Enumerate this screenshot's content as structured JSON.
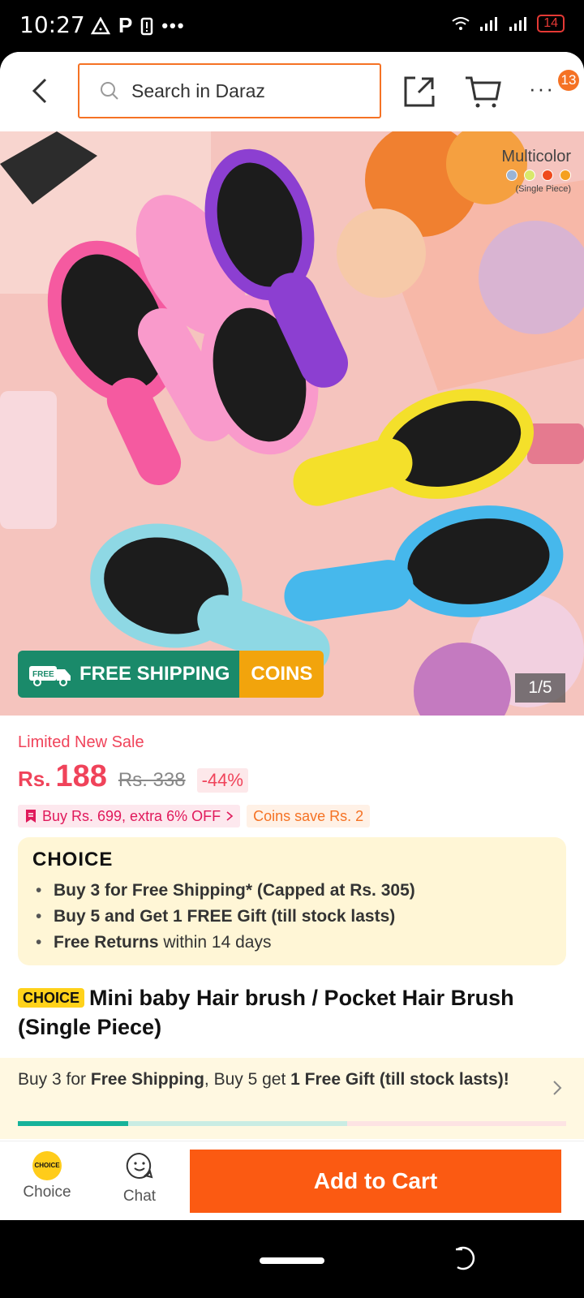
{
  "status_bar": {
    "time": "10:27",
    "left_icons": [
      "alert-icon",
      "parking-icon",
      "battery-alert-icon",
      "more-dots-icon"
    ],
    "battery": "14"
  },
  "top_bar": {
    "search_placeholder": "Search in Daraz",
    "cart_badge": "13"
  },
  "hero": {
    "multicolor_title": "Multicolor",
    "multicolor_sub": "(Single Piece)",
    "swatch_colors": [
      "#9ab4d6",
      "#d9e86b",
      "#ef4a1c",
      "#f5a020"
    ],
    "free_shipping": "FREE SHIPPING",
    "free_tag": "FREE",
    "coins": "COINS",
    "image_counter": "1/5"
  },
  "product": {
    "sale_label": "Limited New Sale",
    "currency": "Rs.",
    "price": "188",
    "old_price": "Rs. 338",
    "discount": "-44%",
    "promo_tag": "Buy Rs. 699, extra 6% OFF",
    "coins_tag": "Coins save Rs. 2",
    "title_badge": "CHOICE",
    "title": "Mini baby Hair brush / Pocket Hair Brush (Single Piece)"
  },
  "choice_box": {
    "logo": "CHOICE",
    "item1": "Buy 3 for  Free Shipping* (Capped at Rs. 305)",
    "item2": "Buy 5 and Get 1 FREE Gift (till stock lasts)",
    "item3_bold": "Free Returns",
    "item3_rest": " within 14 days"
  },
  "bundle_bar": {
    "part1": "Buy 3 for ",
    "bold1": "Free Shipping",
    "part2": ", Buy 5 get ",
    "bold2": "1 Free Gift (till stock lasts)!",
    "progress": 0.2
  },
  "bottom_bar": {
    "choice_label": "Choice",
    "choice_coin": "CHOICE",
    "chat_label": "Chat",
    "add_to_cart": "Add to Cart"
  }
}
